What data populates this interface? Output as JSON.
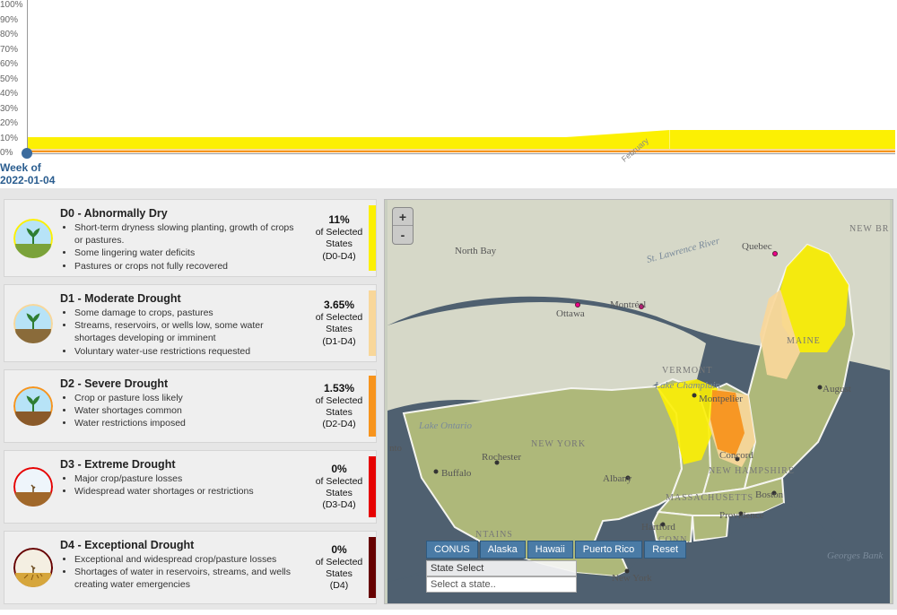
{
  "chart_data": {
    "type": "area",
    "title": "",
    "xlabel": "",
    "ylabel": "",
    "ylim": [
      0,
      100
    ],
    "y_ticks": [
      "0%",
      "10%",
      "20%",
      "30%",
      "40%",
      "50%",
      "60%",
      "70%",
      "80%",
      "90%",
      "100%"
    ],
    "x_labels": [
      "February"
    ],
    "series": [
      {
        "name": "D0-D4",
        "color": "#fcf003",
        "values": [
          11,
          11,
          11,
          11,
          14,
          16,
          17,
          17
        ]
      },
      {
        "name": "D1-D4",
        "color": "#f8d79a",
        "values": [
          3.6,
          3.6,
          3.6,
          3.6,
          3.6,
          3.6,
          3.6,
          3.6
        ]
      },
      {
        "name": "D2-D4",
        "color": "#f7941d",
        "values": [
          1.5,
          1.5,
          1.5,
          1.5,
          1.5,
          1.5,
          1.5,
          1.5
        ]
      },
      {
        "name": "D3-D4",
        "color": "#e60000",
        "values": [
          0,
          0,
          0,
          0,
          0,
          0,
          0,
          0
        ]
      },
      {
        "name": "D4",
        "color": "#660000",
        "values": [
          0,
          0,
          0,
          0,
          0,
          0,
          0,
          0
        ]
      }
    ]
  },
  "timeline": {
    "week_label_line1": "Week of",
    "week_label_line2": "2022-01-04"
  },
  "map": {
    "zoom_in": "+",
    "zoom_out": "-",
    "region_buttons": [
      "CONUS",
      "Alaska",
      "Hawaii",
      "Puerto Rico",
      "Reset"
    ],
    "state_select_label": "State Select",
    "state_select_placeholder": "Select a state..",
    "labels": {
      "north_bay": "North Bay",
      "quebec": "Quebec",
      "ottawa": "Ottawa",
      "montreal": "Montréal",
      "maine": "MAINE",
      "vermont": "VERMONT",
      "montpelier": "Montpelier",
      "lake_champlain": "Lake Champlain",
      "st_lawrence": "St. Lawrence River",
      "lake_ontario": "Lake Ontario",
      "nto": "nto",
      "new_york": "NEW YORK",
      "buffalo": "Buffalo",
      "rochester": "Rochester",
      "albany": "Albany",
      "nh": "NEW HAMPSHIRE",
      "concord": "Concord",
      "massachusetts": "MASSACHUSETTS",
      "boston": "Boston",
      "hartford": "Hartford",
      "conn": "CONN.",
      "providence": "Providence",
      "ny_city": "New York",
      "georges_bank": "Georges Bank",
      "ntains": "NTAINS",
      "augusta": "August",
      "newbr": "NEW BR"
    }
  },
  "cards": [
    {
      "title": "D0 - Abnormally Dry",
      "bullets": [
        "Short-term dryness slowing planting, growth of crops or pastures.",
        "Some lingering water deficits",
        "Pastures or crops not fully recovered"
      ],
      "pct": "11%",
      "pct_label1": "of Selected",
      "pct_label2": "States",
      "range": "(D0-D4)",
      "color": "#fcf003",
      "icon": {
        "ring": "#fcf003",
        "sky": "#b7e3f7",
        "ground": "#7aa23a",
        "sprout": true
      }
    },
    {
      "title": "D1 - Moderate Drought",
      "bullets": [
        "Some damage to crops, pastures",
        "Streams, reservoirs, or wells low, some water shortages developing or imminent",
        "Voluntary water-use restrictions requested"
      ],
      "pct": "3.65%",
      "pct_label1": "of Selected",
      "pct_label2": "States",
      "range": "(D1-D4)",
      "color": "#f8d79a",
      "icon": {
        "ring": "#f8d79a",
        "sky": "#b7e3f7",
        "ground": "#8a6b3a",
        "sprout": true
      }
    },
    {
      "title": "D2 - Severe Drought",
      "bullets": [
        "Crop or pasture loss likely",
        "Water shortages common",
        "Water restrictions imposed"
      ],
      "pct": "1.53%",
      "pct_label1": "of Selected",
      "pct_label2": "States",
      "range": "(D2-D4)",
      "color": "#f7941d",
      "icon": {
        "ring": "#f7941d",
        "sky": "#b7e3f7",
        "ground": "#8a5a2a",
        "sprout": true
      }
    },
    {
      "title": "D3 - Extreme Drought",
      "bullets": [
        "Major crop/pasture losses",
        "Widespread water shortages or restrictions"
      ],
      "pct": "0%",
      "pct_label1": "of Selected",
      "pct_label2": "States",
      "range": "(D3-D4)",
      "color": "#e60000",
      "icon": {
        "ring": "#e60000",
        "sky": "#eef5fb",
        "ground": "#a0682a",
        "sprout": false
      }
    },
    {
      "title": "D4 - Exceptional Drought",
      "bullets": [
        "Exceptional and widespread crop/pasture losses",
        "Shortages of water in reservoirs, streams, and wells creating water emergencies"
      ],
      "pct": "0%",
      "pct_label1": "of Selected",
      "pct_label2": "States",
      "range": "(D4)",
      "color": "#660000",
      "icon": {
        "ring": "#660000",
        "sky": "#f4efe2",
        "ground": "#d6a63c",
        "sprout": false,
        "cracks": true
      }
    }
  ]
}
